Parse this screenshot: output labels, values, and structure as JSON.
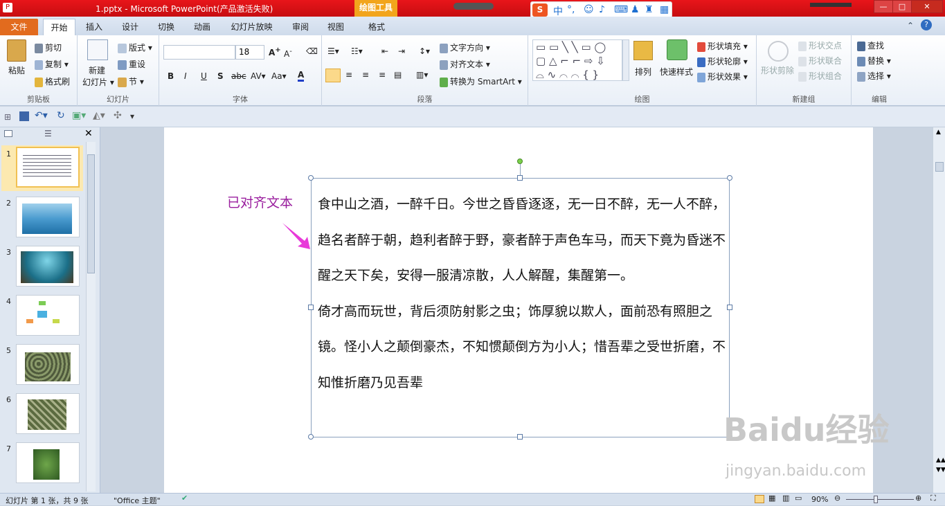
{
  "window": {
    "title": "1.pptx - Microsoft PowerPoint(产品激活失败)",
    "context_tab": "绘图工具"
  },
  "tabs": [
    {
      "label": "文件"
    },
    {
      "label": "开始"
    },
    {
      "label": "插入"
    },
    {
      "label": "设计"
    },
    {
      "label": "切换"
    },
    {
      "label": "动画"
    },
    {
      "label": "幻灯片放映"
    },
    {
      "label": "审阅"
    },
    {
      "label": "视图"
    },
    {
      "label": "格式"
    }
  ],
  "ribbon": {
    "clipboard": {
      "paste": "粘贴",
      "cut": "剪切",
      "copy": "复制",
      "format_painter": "格式刷",
      "label": "剪贴板"
    },
    "slides": {
      "new_slide_1": "新建",
      "new_slide_2": "幻灯片",
      "layout": "版式",
      "reset": "重设",
      "section": "节",
      "label": "幻灯片"
    },
    "font": {
      "name": "",
      "size": "18",
      "label": "字体"
    },
    "paragraph": {
      "text_direction": "文字方向",
      "align_text": "对齐文本",
      "smartart": "转换为 SmartArt",
      "label": "段落"
    },
    "drawing": {
      "arrange": "排列",
      "quick_styles": "快速样式",
      "fill": "形状填充",
      "outline": "形状轮廓",
      "effects": "形状效果",
      "label": "绘图"
    },
    "new_group": {
      "shape_cut": "形状剪除",
      "shape_intersect": "形状交点",
      "shape_union": "形状联合",
      "shape_combine": "形状组合",
      "label": "新建组"
    },
    "editing": {
      "find": "查找",
      "replace": "替换",
      "select": "选择",
      "label": "编辑"
    }
  },
  "slides": [
    {
      "num": "1"
    },
    {
      "num": "2"
    },
    {
      "num": "3"
    },
    {
      "num": "4"
    },
    {
      "num": "5"
    },
    {
      "num": "6"
    },
    {
      "num": "7"
    }
  ],
  "slide": {
    "annotation": "已对齐文本",
    "paragraph1": "食中山之酒，一醉千日。今世之昏昏逐逐，无一日不醉，无一人不醉，趋名者醉于朝，趋利者醉于野，豪者醉于声色车马，而天下竟为昏迷不醒之天下矣，安得一服清凉散，人人解醒，集醒第一。",
    "paragraph2": "倚才高而玩世，背后须防射影之虫；饰厚貌以欺人，面前恐有照胆之镜。怪小人之颠倒豪杰，不知惯颠倒方为小人；惜吾辈之受世折磨，不知惟折磨乃见吾辈"
  },
  "status": {
    "slide_info": "幻灯片 第 1 张，共 9 张",
    "theme": "\"Office 主题\"",
    "zoom": "90%"
  },
  "watermark": {
    "logo": "Baidu经验",
    "url": "jingyan.baidu.com"
  },
  "colors": {
    "file_tab": "#e26b1e",
    "title_bar": "#e8151a",
    "annotation": "#9a1e9e",
    "arrow": "#e83ad9"
  }
}
